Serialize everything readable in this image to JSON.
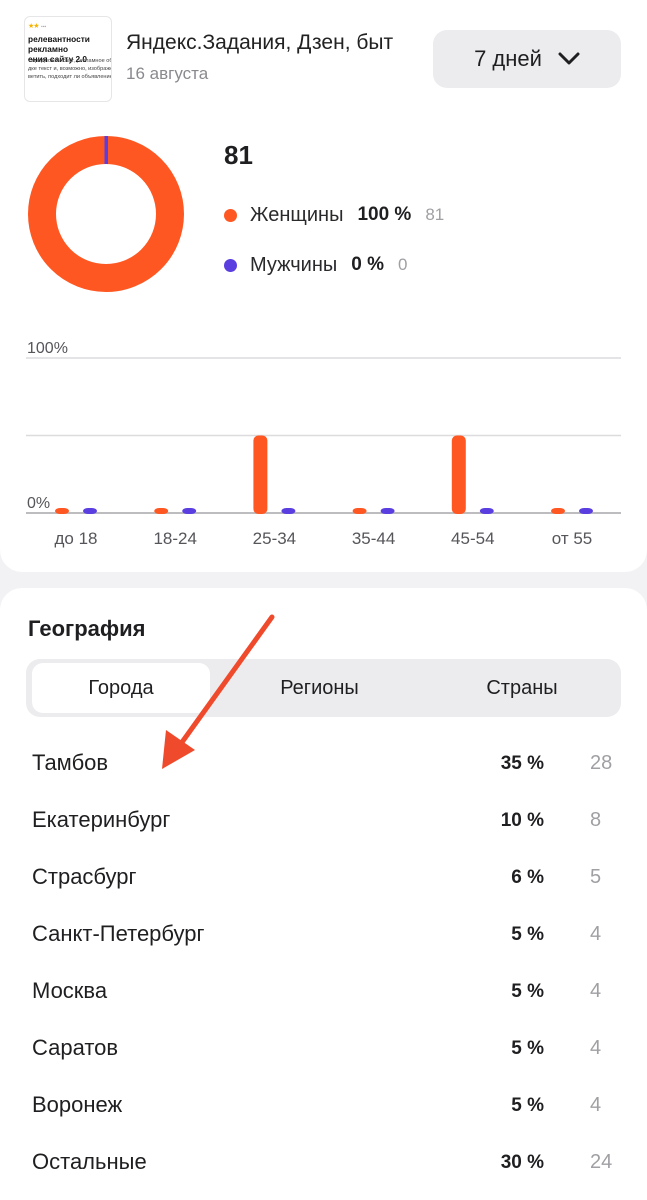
{
  "header": {
    "title": "Яндекс.Задания, Дзен, быт",
    "date": "16 августа",
    "period_label": "7 дней",
    "thumbnail": {
      "title": "релевантности рекламно\nения сайту 2.0",
      "body": "т предложен сайт, рекламное объ\nдке текст и, возможно, изображе\nветить, подходит ли объявление с"
    }
  },
  "gender": {
    "total": "81",
    "items": [
      {
        "label": "Женщины",
        "percent": "100 %",
        "count": "81",
        "color": "#ff5722"
      },
      {
        "label": "Мужчины",
        "percent": "0 %",
        "count": "0",
        "color": "#5a3ee0"
      }
    ]
  },
  "chart_data": {
    "type": "bar",
    "y_tick_labels": [
      "100%",
      "0%"
    ],
    "ylim": [
      0,
      100
    ],
    "categories": [
      "до 18",
      "18-24",
      "25-34",
      "35-44",
      "45-54",
      "от 55"
    ],
    "series": [
      {
        "name": "Женщины",
        "color": "#ff5722",
        "values": [
          0,
          0,
          50,
          0,
          50,
          0
        ]
      },
      {
        "name": "Мужчины",
        "color": "#5a3ee0",
        "values": [
          0,
          0,
          0,
          0,
          0,
          0
        ]
      }
    ],
    "grid": true
  },
  "geography": {
    "title": "География",
    "tabs": [
      {
        "label": "Города",
        "active": true
      },
      {
        "label": "Регионы",
        "active": false
      },
      {
        "label": "Страны",
        "active": false
      }
    ],
    "rows": [
      {
        "name": "Тамбов",
        "percent": "35 %",
        "count": "28"
      },
      {
        "name": "Екатеринбург",
        "percent": "10 %",
        "count": "8"
      },
      {
        "name": "Страсбург",
        "percent": "6 %",
        "count": "5"
      },
      {
        "name": "Санкт-Петербург",
        "percent": "5 %",
        "count": "4"
      },
      {
        "name": "Москва",
        "percent": "5 %",
        "count": "4"
      },
      {
        "name": "Саратов",
        "percent": "5 %",
        "count": "4"
      },
      {
        "name": "Воронеж",
        "percent": "5 %",
        "count": "4"
      },
      {
        "name": "Остальные",
        "percent": "30 %",
        "count": "24"
      }
    ]
  },
  "annotation": {
    "arrow_color": "#f04a2c"
  }
}
